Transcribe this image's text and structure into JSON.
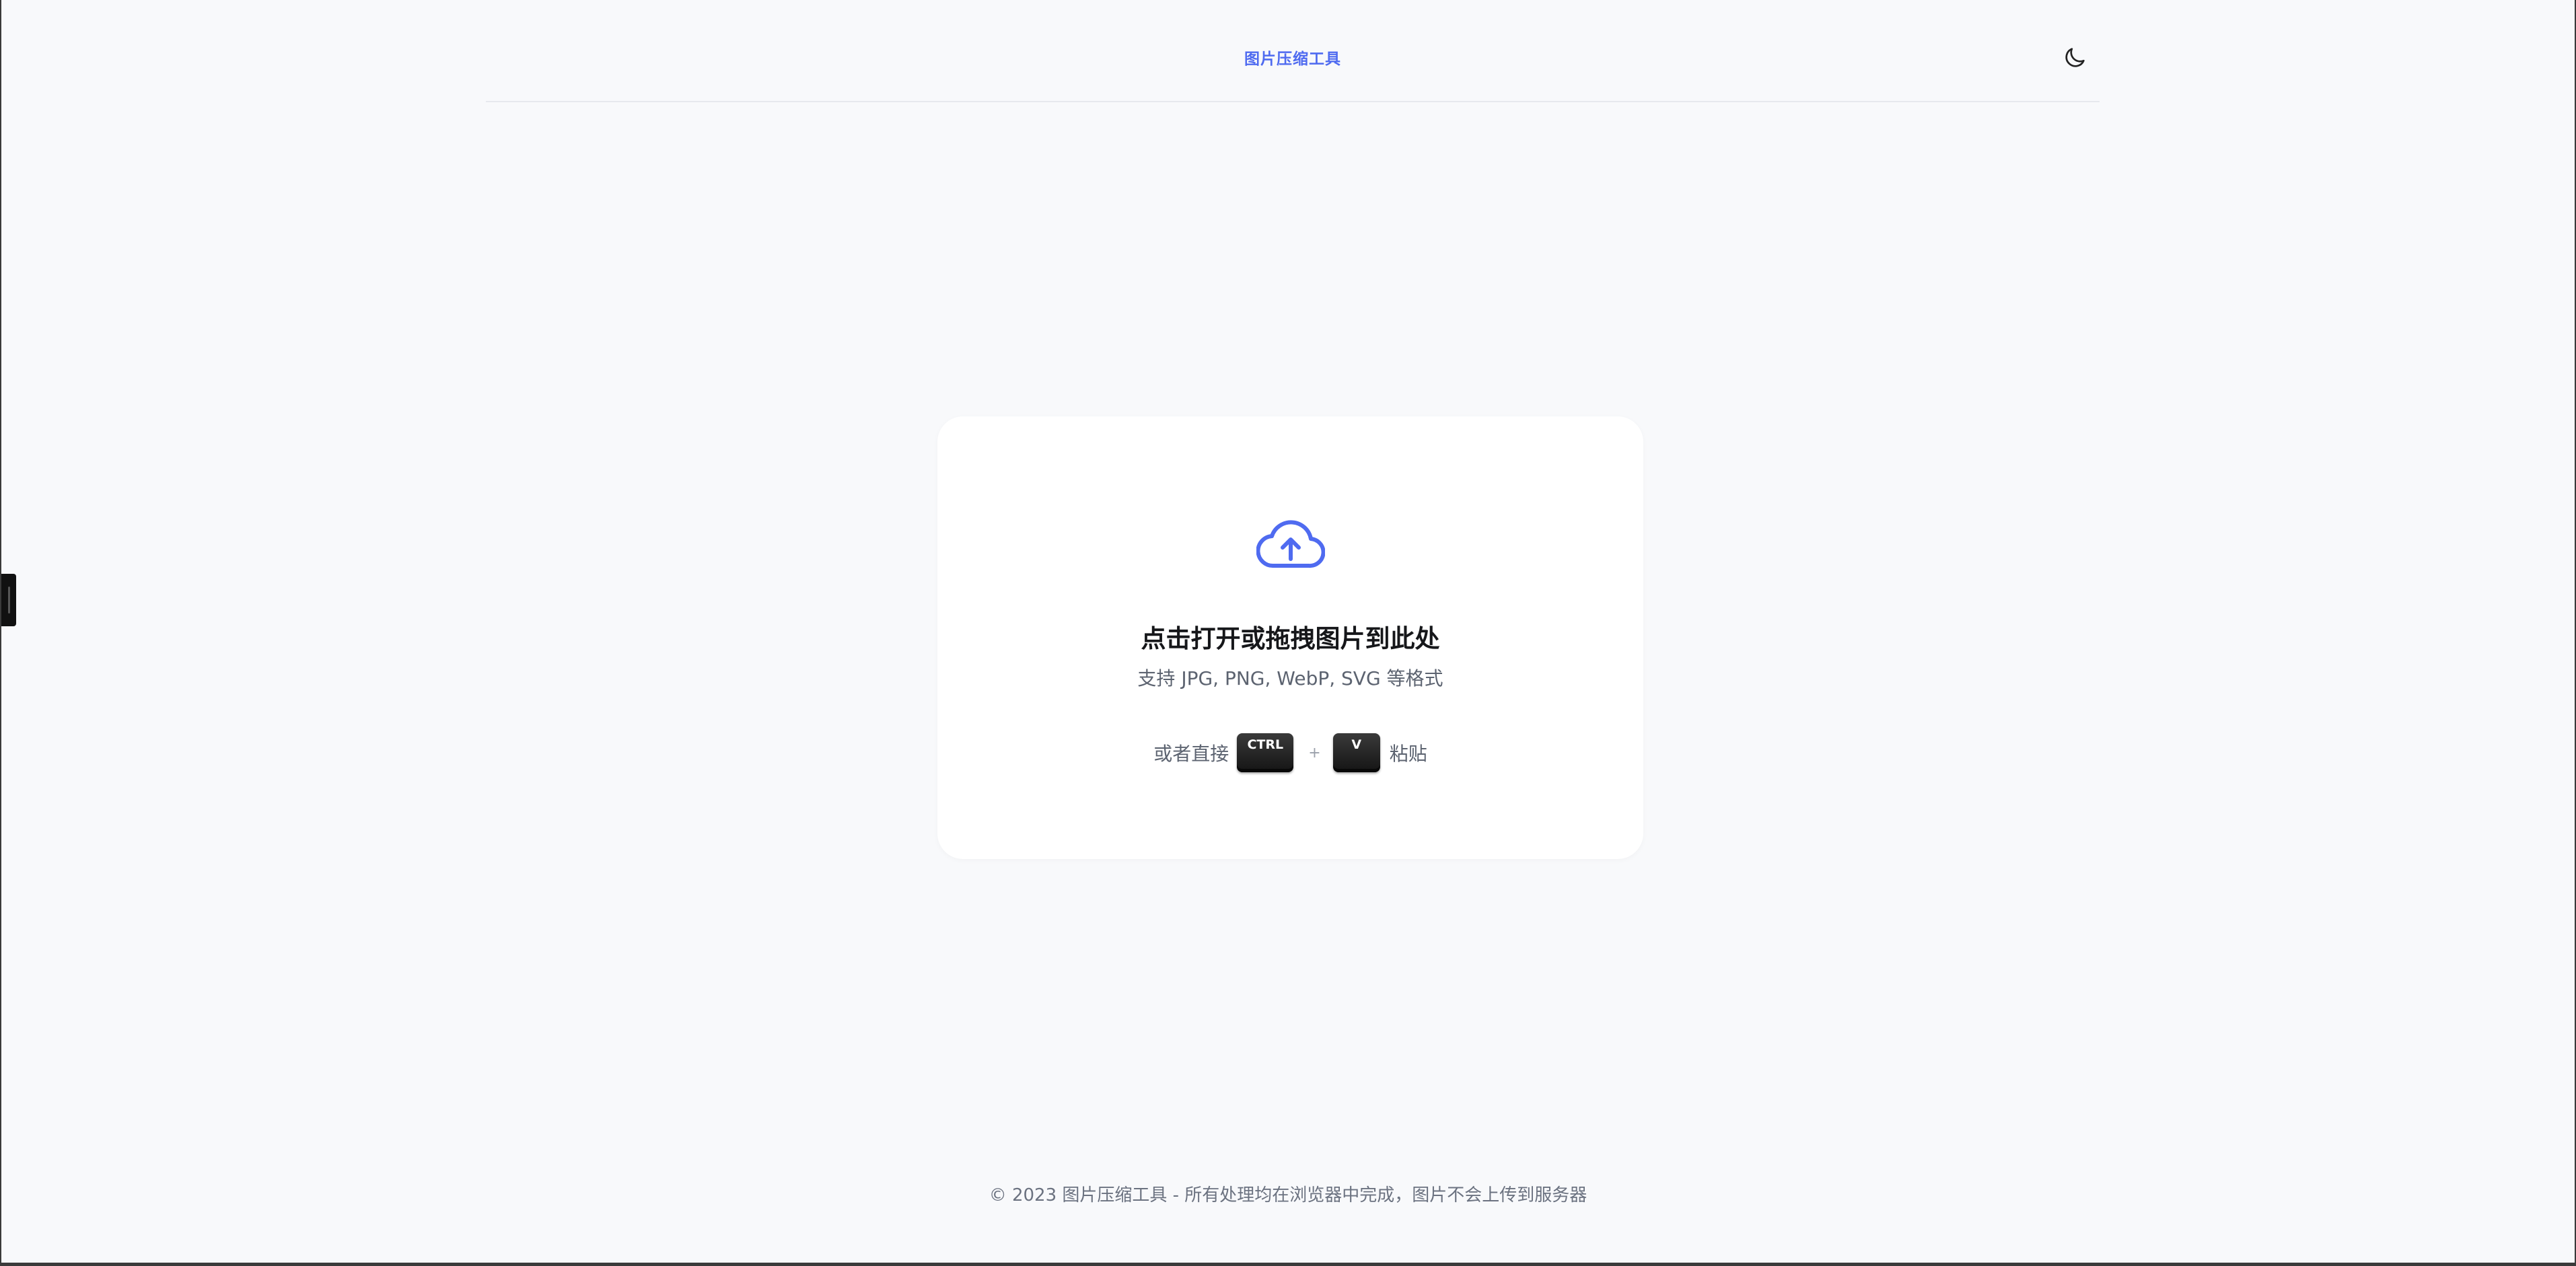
{
  "header": {
    "brand": "图片压缩工具",
    "theme_toggle_icon": "moon-icon"
  },
  "upload": {
    "icon": "cloud-upload-icon",
    "title": "点击打开或拖拽图片到此处",
    "subtitle": "支持 JPG, PNG, WebP, SVG 等格式",
    "shortcut_prefix": "或者直接",
    "key_ctrl": "CTRL",
    "plus": "+",
    "key_v": "V",
    "shortcut_suffix": "粘贴"
  },
  "footer": {
    "text": "© 2023 图片压缩工具 - 所有处理均在浏览器中完成，图片不会上传到服务器"
  },
  "colors": {
    "accent": "#4f6bf0",
    "background": "#f8f9fb",
    "card": "#ffffff"
  }
}
